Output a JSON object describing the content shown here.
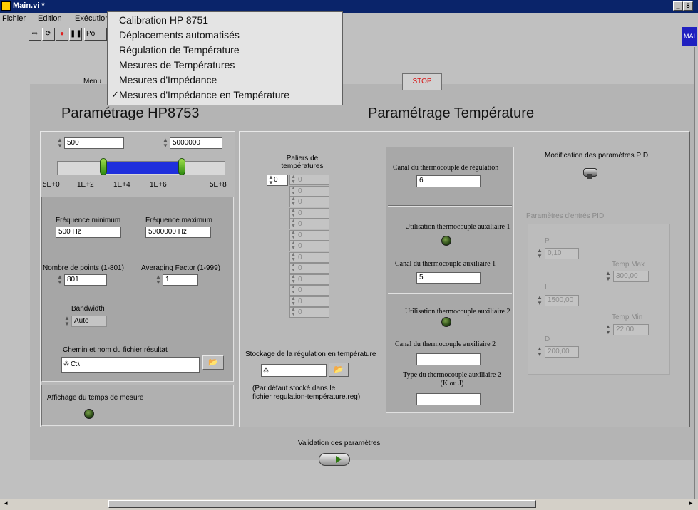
{
  "window": {
    "title": "Main.vi *",
    "btn_min": "_",
    "btn_max": "8"
  },
  "menubar": {
    "file": "Fichier",
    "edit": "Edition",
    "exec": "Exécution"
  },
  "toolbar": {
    "font_field": "Po",
    "right_badge": "MAI"
  },
  "menu_label": "Menu",
  "dropdown": {
    "items": [
      "Calibration HP 8751",
      "Déplacements automatisés",
      "Régulation de Température",
      "Mesures de Températures",
      "Mesures  d'Impédance",
      "Mesures d'Impédance en Température"
    ],
    "checkmark": "✓",
    "selected_index": 5
  },
  "stop_label": "STOP",
  "left": {
    "title": "Paramétrage HP8753",
    "range_min": "500",
    "range_max": "5000000",
    "ticks": [
      "5E+0",
      "1E+2",
      "1E+4",
      "1E+6",
      "5E+8"
    ],
    "freq_min_label": "Fréquence minimum",
    "freq_min_value": "500 Hz",
    "freq_max_label": "Fréquence maximum",
    "freq_max_value": "5000000 Hz",
    "points_label": "Nombre de points (1-801)",
    "points_value": "801",
    "avg_label": "Averaging Factor (1-999)",
    "avg_value": "1",
    "bandwidth_label": "Bandwidth",
    "bandwidth_value": "Auto",
    "path_label": "Chemin et nom du fichier résultat",
    "path_value": "C:\\",
    "display_time_label": "Affichage du temps de mesure"
  },
  "right": {
    "title": "Paramétrage Température",
    "paliers_label": "Paliers de températures",
    "paliers_index": "0",
    "paliers_values": [
      "0",
      "0",
      "0",
      "0",
      "0",
      "0",
      "0",
      "0",
      "0",
      "0",
      "0",
      "0",
      "0"
    ],
    "storage_label": "Stockage de la régulation en température",
    "storage_value": "",
    "storage_note_1": "(Par défaut stocké dans le",
    "storage_note_2": "fichier regulation-température.reg)",
    "canal_reg_label": "Canal du thermocouple de régulation",
    "canal_reg_value": "6",
    "aux1_use_label": "Utilisation thermocouple auxiliaire 1",
    "aux1_canal_label": "Canal du thermocouple auxiliaire 1",
    "aux1_canal_value": "5",
    "aux2_use_label": "Utilisation thermocouple auxiliaire 2",
    "aux2_canal_label": "Canal du thermocouple auxiliaire 2",
    "aux2_canal_value": "",
    "aux2_type_label_1": "Type du thermocouple auxiliaire 2",
    "aux2_type_label_2": "(K ou J)",
    "aux2_type_value": "",
    "pid_mod_label": "Modification des paramètres PID",
    "pid_params_label": "Paramètres d'entrés PID",
    "p_label": "P",
    "p_value": "0,10",
    "i_label": "I",
    "i_value": "1500,00",
    "d_label": "D",
    "d_value": "200,00",
    "tmax_label": "Temp Max",
    "tmax_value": "300,00",
    "tmin_label": "Temp Min",
    "tmin_value": "22,00"
  },
  "validate_label": "Validation des paramètres",
  "colors": {
    "titlebar": "#0a246a",
    "slider_fill": "#1f2fdc",
    "stop_text": "#d81010"
  }
}
